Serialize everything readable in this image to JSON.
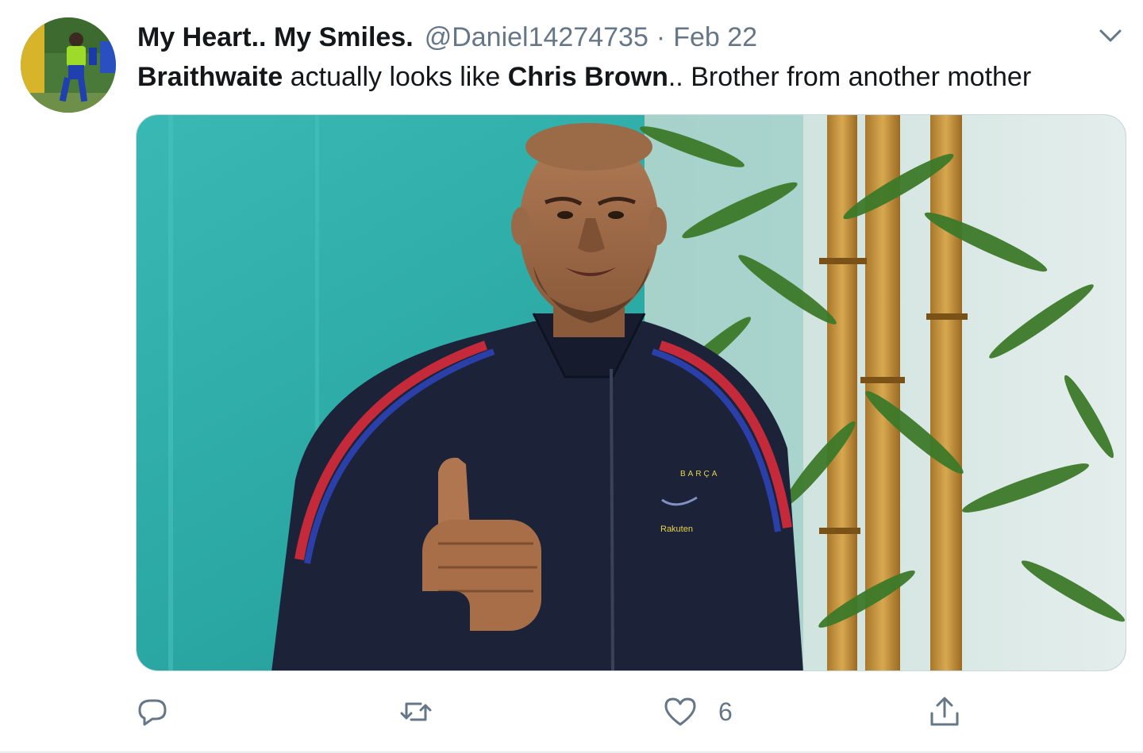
{
  "tweet": {
    "display_name": "My Heart.. My Smiles.",
    "handle": "@Daniel14274735",
    "separator": "·",
    "date": "Feb 22",
    "text": {
      "part1_bold": "Braithwaite",
      "part2": " actually looks like ",
      "part3_bold": "Chris Brown",
      "part4": ".. Brother from another mother"
    },
    "media": {
      "description_icon": "photo",
      "jacket_logo_text": "BARÇA",
      "jacket_sponsor_text": "Rakuten"
    },
    "actions": {
      "reply_icon": "reply-icon",
      "retweet_icon": "retweet-icon",
      "like_icon": "heart-icon",
      "like_count": "6",
      "share_icon": "share-icon"
    }
  },
  "colors": {
    "text_primary": "#14171a",
    "text_secondary": "#657786",
    "border": "#e6ecf0"
  }
}
